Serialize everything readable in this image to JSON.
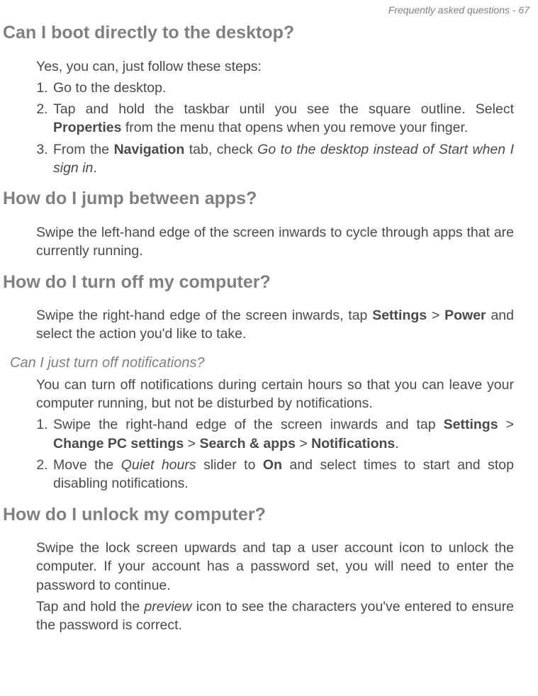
{
  "header": {
    "text": "Frequently asked questions - 67"
  },
  "sections": [
    {
      "heading": "Can I boot directly to the desktop?",
      "intro": "Yes, you can, just follow these steps:",
      "steps": [
        "Go to the desktop.",
        "Tap and hold the taskbar until you see the square outline. Select <b>Properties</b> from the menu that opens when you remove your finger.",
        "From the <b>Navigation</b> tab, check <i>Go to the desktop instead of Start when I sign in</i>."
      ]
    },
    {
      "heading": "How do I jump between apps?",
      "body": "Swipe the left-hand edge of the screen inwards to cycle through apps that are currently running."
    },
    {
      "heading": "How do I turn off my computer?",
      "body": "Swipe the right-hand edge of the screen inwards, tap <b>Settings</b> > <b>Power</b> and select the action you'd like to take.",
      "subquestion": "Can I just turn off notifications?",
      "subbody": "You can turn off notifications during certain hours so that you can leave your computer running, but not be disturbed by notifications.",
      "substeps": [
        "Swipe the right-hand edge of the screen inwards and tap <b>Settings</b> > <b>Change PC settings</b> > <b>Search & apps</b> > <b>Notifications</b>.",
        "Move the <i>Quiet hours</i> slider to <b>On</b> and select times to start and stop disabling notifications."
      ]
    },
    {
      "heading": "How do I unlock my computer?",
      "body": "Swipe the lock screen upwards and tap a user account icon to unlock the computer. If your account has a password set, you will need to enter the password to continue.",
      "body2": "Tap and hold the <i>preview</i> icon to see the characters you've entered to ensure the password is correct."
    }
  ]
}
